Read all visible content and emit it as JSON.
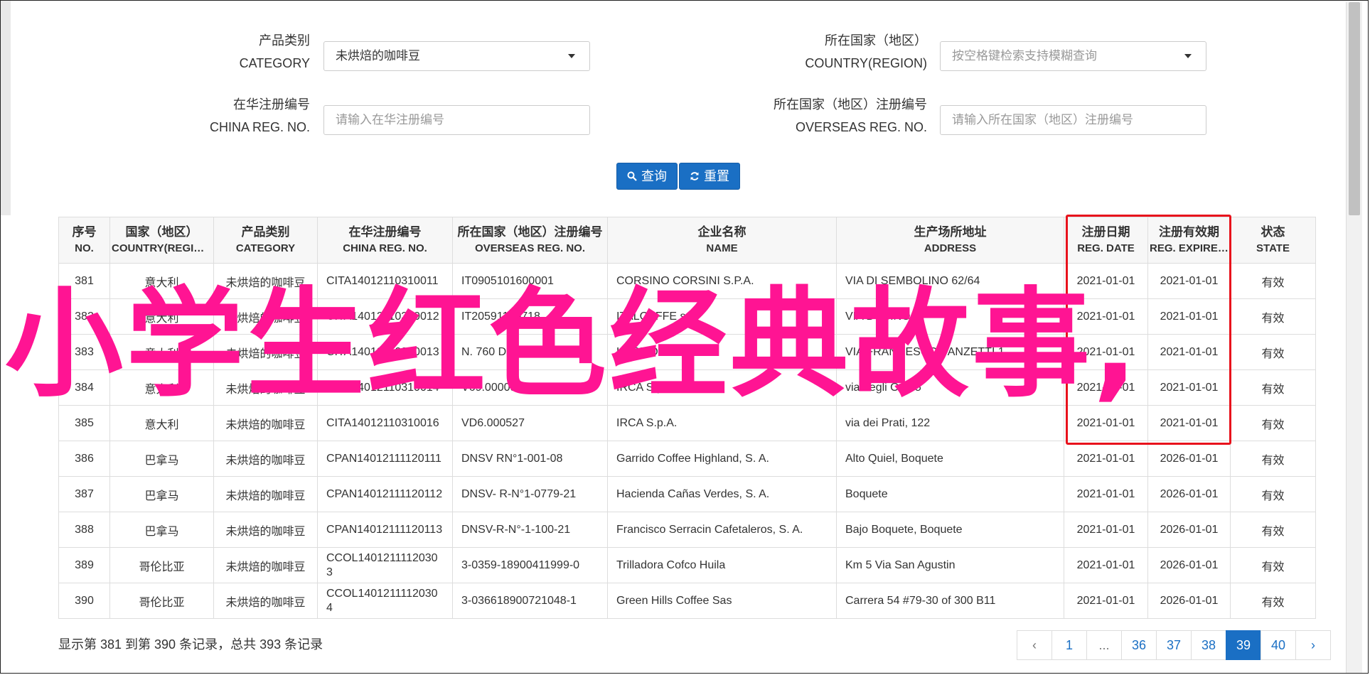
{
  "filters": {
    "category": {
      "label_cn": "产品类别",
      "label_en": "CATEGORY",
      "value": "未烘焙的咖啡豆"
    },
    "country": {
      "label_cn": "所在国家（地区）",
      "label_en": "COUNTRY(REGION)",
      "placeholder": "按空格键检索支持模糊查询"
    },
    "china_reg": {
      "label_cn": "在华注册编号",
      "label_en": "CHINA REG. NO.",
      "placeholder": "请输入在华注册编号"
    },
    "overseas_reg": {
      "label_cn": "所在国家（地区）注册编号",
      "label_en": "OVERSEAS REG. NO.",
      "placeholder": "请输入所在国家（地区）注册编号"
    },
    "search_label": "查询",
    "reset_label": "重置"
  },
  "table": {
    "headers": [
      {
        "cn": "序号",
        "en": "NO."
      },
      {
        "cn": "国家（地区）",
        "en": "COUNTRY(REGION)"
      },
      {
        "cn": "产品类别",
        "en": "CATEGORY"
      },
      {
        "cn": "在华注册编号",
        "en": "CHINA REG. NO."
      },
      {
        "cn": "所在国家（地区）注册编号",
        "en": "OVERSEAS REG. NO."
      },
      {
        "cn": "企业名称",
        "en": "NAME"
      },
      {
        "cn": "生产场所地址",
        "en": "ADDRESS"
      },
      {
        "cn": "注册日期",
        "en": "REG. DATE"
      },
      {
        "cn": "注册有效期",
        "en": "REG. EXPIRE DATE"
      },
      {
        "cn": "状态",
        "en": "STATE"
      }
    ],
    "rows": [
      [
        "381",
        "意大利",
        "未烘焙的咖啡豆",
        "CITA14012110310011",
        "IT0905101600001",
        "CORSINO CORSINI S.P.A.",
        "VIA DI SEMBOLINO 62/64",
        "2021-01-01",
        "2021-01-01",
        "有效"
      ],
      [
        "382",
        "意大利",
        "未烘焙的咖啡豆",
        "CITA14012110310012",
        "IT20591100718",
        "ITALCAFFE srl",
        "VIA DUBINO 1",
        "2021-01-01",
        "2021-01-01",
        "有效"
      ],
      [
        "383",
        "意大利",
        "未烘焙的咖啡豆",
        "CITA14012110310013",
        "N. 760 DEL 09/07/2003",
        "LORMOSA S.a.s",
        "VIA FRANCESCO VANZETTI 1",
        "2021-01-01",
        "2021-01-01",
        "有效"
      ],
      [
        "384",
        "意大利",
        "未烘焙的咖啡豆",
        "CITA14012110310014",
        "V69.000097",
        "IRCA S.p.A.",
        "via degli Orti, 5",
        "2021-01-01",
        "2021-01-01",
        "有效"
      ],
      [
        "385",
        "意大利",
        "未烘焙的咖啡豆",
        "CITA14012110310016",
        "VD6.000527",
        "IRCA S.p.A.",
        "via dei Prati, 122",
        "2021-01-01",
        "2021-01-01",
        "有效"
      ],
      [
        "386",
        "巴拿马",
        "未烘焙的咖啡豆",
        "CPAN14012111120111",
        "DNSV RN°1-001-08",
        "Garrido Coffee Highland, S. A.",
        "Alto Quiel, Boquete",
        "2021-01-01",
        "2026-01-01",
        "有效"
      ],
      [
        "387",
        "巴拿马",
        "未烘焙的咖啡豆",
        "CPAN14012111120112",
        "DNSV- R-N°1-0779-21",
        "Hacienda Cañas Verdes, S. A.",
        "Boquete",
        "2021-01-01",
        "2026-01-01",
        "有效"
      ],
      [
        "388",
        "巴拿马",
        "未烘焙的咖啡豆",
        "CPAN14012111120113",
        "DNSV-R-N°-1-100-21",
        "Francisco Serracin Cafetaleros, S. A.",
        "Bajo Boquete, Boquete",
        "2021-01-01",
        "2026-01-01",
        "有效"
      ],
      [
        "389",
        "哥伦比亚",
        "未烘焙的咖啡豆",
        "CCOL14012111120303",
        "3-0359-18900411999-0",
        "Trilladora Cofco Huila",
        "Km 5 Via San Agustin",
        "2021-01-01",
        "2026-01-01",
        "有效"
      ],
      [
        "390",
        "哥伦比亚",
        "未烘焙的咖啡豆",
        "CCOL14012111120304",
        "3-036618900721048-1",
        "Green Hills Coffee Sas",
        "Carrera 54 #79-30 of 300 B11",
        "2021-01-01",
        "2026-01-01",
        "有效"
      ]
    ]
  },
  "summary": "显示第 381 到第 390 条记录，总共 393 条记录",
  "pagination": {
    "prev": "‹",
    "pages": [
      "1",
      "...",
      "36",
      "37",
      "38",
      "39",
      "40"
    ],
    "active": "39",
    "next": "›"
  },
  "overlay_text": "小学生红色经典故事,",
  "colors": {
    "accent": "#1a6fc4",
    "highlight_border": "#e8121c",
    "overlay": "#ff1493"
  }
}
